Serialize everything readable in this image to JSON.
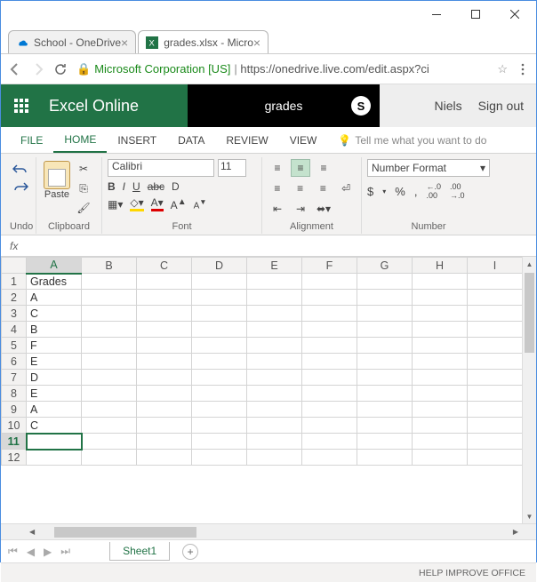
{
  "browser": {
    "tabs": [
      {
        "title": "School - OneDrive"
      },
      {
        "title": "grades.xlsx - Micro"
      }
    ],
    "url_ev": "Microsoft Corporation [US]",
    "url_rest": "https://onedrive.live.com/edit.aspx?ci",
    "star": "☆"
  },
  "app": {
    "brand": "Excel Online",
    "docname": "grades",
    "user": "Niels",
    "signout": "Sign out"
  },
  "ribbon_tabs": {
    "file": "FILE",
    "home": "HOME",
    "insert": "INSERT",
    "data": "DATA",
    "review": "REVIEW",
    "view": "VIEW",
    "tellme": "Tell me what you want to do"
  },
  "ribbon": {
    "undo_label": "Undo",
    "paste_label": "Paste",
    "clipboard_label": "Clipboard",
    "font_name": "Calibri",
    "font_size": "11",
    "font_label": "Font",
    "alignment_label": "Alignment",
    "number_format": "Number Format",
    "number_label": "Number",
    "bold": "B",
    "italic": "I",
    "underline": "U",
    "strike": "abc",
    "double": "D",
    "dollar": "$",
    "percent": "%",
    "comma": ",",
    "inc": ".0 .00",
    "dec": ".00 .0"
  },
  "formula_bar": {
    "fx": "fx"
  },
  "sheet": {
    "columns": [
      "A",
      "B",
      "C",
      "D",
      "E",
      "F",
      "G",
      "H",
      "I"
    ],
    "rows": [
      "1",
      "2",
      "3",
      "4",
      "5",
      "6",
      "7",
      "8",
      "9",
      "10",
      "11",
      "12"
    ],
    "selected_col": "A",
    "selected_row": "11",
    "data": {
      "A1": "Grades",
      "A2": "A",
      "A3": "C",
      "A4": "B",
      "A5": "F",
      "A6": "E",
      "A7": "D",
      "A8": "E",
      "A9": "A",
      "A10": "C"
    },
    "tab_name": "Sheet1"
  },
  "status": {
    "help": "HELP IMPROVE OFFICE"
  }
}
